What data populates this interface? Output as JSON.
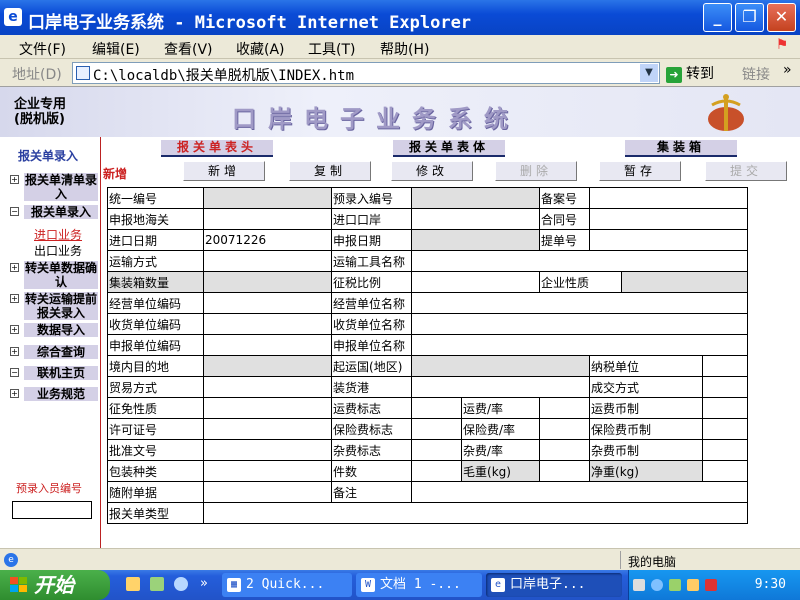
{
  "window": {
    "title": "口岸电子业务系统 - Microsoft Internet Explorer",
    "minimize": "_",
    "maximize": "❐",
    "close": "✕"
  },
  "menu": [
    "文件(F)",
    "编辑(E)",
    "查看(V)",
    "收藏(A)",
    "工具(T)",
    "帮助(H)"
  ],
  "address": {
    "label": "地址(D)",
    "url": "C:\\localdb\\报关单脱机版\\INDEX.htm",
    "go": "转到",
    "links": "链接",
    "more": "»"
  },
  "banner": {
    "enterprise_line1": "企业专用",
    "enterprise_line2": "(脱机版)",
    "system_name": "口岸电子业务系统"
  },
  "sidebar": {
    "header": "报关单录入",
    "items": [
      {
        "toggle": "+",
        "label": "报关单清单录入"
      },
      {
        "toggle": "−",
        "label": "报关单录入"
      },
      {
        "toggle": "+",
        "label": "转关单数据确认"
      },
      {
        "toggle": "+",
        "label": "转关运输提前报关录入"
      },
      {
        "toggle": "+",
        "label": "数据导入"
      },
      {
        "toggle": "+",
        "label": "综合查询"
      },
      {
        "toggle": "−",
        "label": "联机主页"
      },
      {
        "toggle": "+",
        "label": "业务规范"
      }
    ],
    "sub_import": "进口业务",
    "sub_export": "出口业务",
    "operator_label": "预录入员编号",
    "operator_value": ""
  },
  "tabs": [
    "报关单表头",
    "报关单表体",
    "集装箱"
  ],
  "actions": {
    "mode": "新增",
    "buttons": [
      {
        "label": "新增",
        "enabled": true
      },
      {
        "label": "复制",
        "enabled": true
      },
      {
        "label": "修改",
        "enabled": true
      },
      {
        "label": "删除",
        "enabled": false
      },
      {
        "label": "暂存",
        "enabled": true
      },
      {
        "label": "提交",
        "enabled": false
      }
    ]
  },
  "form": {
    "unified_no": "统一编号",
    "pre_entry_no": "预录入编号",
    "record_no": "备案号",
    "declare_customs": "申报地海关",
    "port": "进口口岸",
    "contract_no": "合同号",
    "import_date": "进口日期",
    "import_date_value": "20071226",
    "declare_date": "申报日期",
    "bill_no": "提单号",
    "transport_mode": "运输方式",
    "transport_tool": "运输工具名称",
    "container_count": "集装箱数量",
    "levy_ratio": "征税比例",
    "company_nature": "企业性质",
    "operator_code": "经营单位编码",
    "operator_name": "经营单位名称",
    "receiver_code": "收货单位编码",
    "receiver_name": "收货单位名称",
    "declarant_code": "申报单位编码",
    "declarant_name": "申报单位名称",
    "domestic_dest": "境内目的地",
    "origin_country": "起运国(地区)",
    "taxpayer": "纳税单位",
    "trade_mode": "贸易方式",
    "loading_port": "装货港",
    "deal_mode": "成交方式",
    "exemption": "征免性质",
    "freight_flag": "运费标志",
    "freight_rate": "运费/率",
    "freight_currency": "运费币制",
    "license_no": "许可证号",
    "insurance_flag": "保险费标志",
    "insurance_rate": "保险费/率",
    "insurance_currency": "保险费币制",
    "approval_no": "批准文号",
    "misc_flag": "杂费标志",
    "misc_rate": "杂费/率",
    "misc_currency": "杂费币制",
    "package_type": "包装种类",
    "pieces": "件数",
    "gross_weight": "毛重(kg)",
    "net_weight": "净重(kg)",
    "attached_docs": "随附单据",
    "remarks": "备注",
    "declaration_type": "报关单类型"
  },
  "status": {
    "zone": "我的电脑"
  },
  "taskbar": {
    "start": "开始",
    "quicklaunch_more": "»",
    "tasks": [
      "2 Quick...",
      "文档 1 -...",
      "口岸电子..."
    ],
    "clock": "9:30"
  }
}
